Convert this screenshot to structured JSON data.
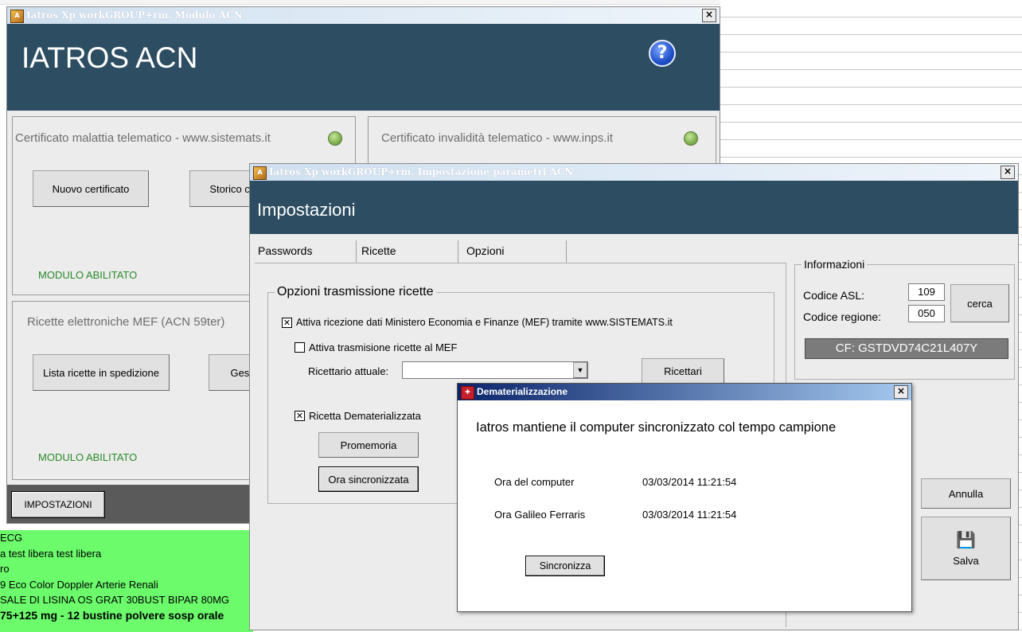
{
  "main_window": {
    "title": "Iatros Xp workGROUP+rm. Modulo ACN",
    "close": "×",
    "header_title": "IATROS ACN",
    "help_icon_label": "?",
    "panel_sick": {
      "title": "Certificato malattia telematico - www.sistemats.it",
      "btn_new": "Nuovo certificato",
      "btn_history": "Storico certificati",
      "status": "MODULO ABILITATO"
    },
    "panel_invalid": {
      "title": "Certificato invalidità telematico - www.inps.it"
    },
    "panel_mef": {
      "title": "Ricette elettroniche MEF (ACN 59ter)",
      "btn_list": "Lista ricette in spedizione",
      "btn_manage": "Gestione ricette",
      "status": "MODULO ABILITATO"
    },
    "btn_settings": "IMPOSTAZIONI"
  },
  "green_list": [
    "ECG",
    "a test libera test libera",
    "ro",
    "9 Eco Color Doppler Arterie Renali",
    "SALE DI LISINA OS GRAT 30BUST BIPAR 80MG",
    "75+125 mg - 12 bustine polvere sosp orale"
  ],
  "settings_window": {
    "title": "Iatros Xp workGROUP+rm. Impostazione parametri ACN",
    "close": "×",
    "header_title": "Impostazioni",
    "tabs": [
      "Passwords",
      "Ricette",
      "Opzioni"
    ],
    "group_transmission": {
      "label": "Opzioni trasmissione ricette",
      "chk_receive": {
        "checked": "✕",
        "label": "Attiva ricezione dati Ministero Economia e Finanze (MEF) tramite www.SISTEMATS.it"
      },
      "chk_transmit": {
        "checked": "",
        "label": "Attiva trasmisione ricette al MEF"
      },
      "ricettario_label": "Ricettario attuale:",
      "ricettario_value": "",
      "dropdown_arrow": "▼",
      "btn_ricettari": "Ricettari",
      "chk_demat": {
        "checked": "✕",
        "label": "Ricetta Dematerializzata"
      },
      "btn_promemoria": "Promemoria",
      "btn_ora": "Ora sincronizzata"
    },
    "info": {
      "label": "Informazioni",
      "asl_label": "Codice ASL:",
      "asl_value": "109",
      "region_label": "Codice regione:",
      "region_value": "050",
      "btn_cerca": "cerca",
      "cf": "CF: GSTDVD74C21L407Y"
    },
    "btn_annulla": "Annulla",
    "btn_salva": "Salva"
  },
  "demat_dialog": {
    "title": "Dematerializzazione",
    "close": "×",
    "message": "Iatros mantiene il computer sincronizzato col tempo campione",
    "computer_label": "Ora del computer",
    "computer_time": "03/03/2014 11:21:54",
    "galileo_label": "Ora Galileo Ferraris",
    "galileo_time": "03/03/2014 11:21:54",
    "btn_sync": "Sincronizza"
  }
}
